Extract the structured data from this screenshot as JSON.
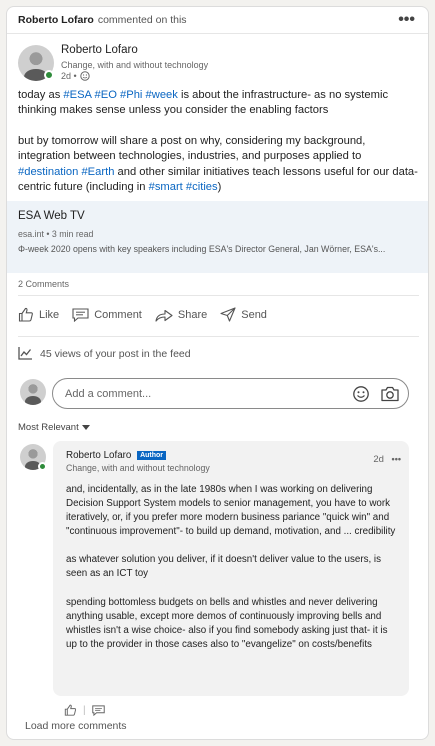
{
  "activity": {
    "author": "Roberto Lofaro",
    "text": "commented on this",
    "more": "•••"
  },
  "post": {
    "author_name": "Roberto Lofaro",
    "headline": "Change, with and without technology",
    "time": "2d •",
    "paragraphs": [
      {
        "segments": [
          {
            "t": "today as "
          },
          {
            "t": "#ESA",
            "tag": true
          },
          {
            "t": " "
          },
          {
            "t": "#EO",
            "tag": true
          },
          {
            "t": " "
          },
          {
            "t": "#Phi",
            "tag": true
          },
          {
            "t": " "
          },
          {
            "t": "#week",
            "tag": true
          },
          {
            "t": " is about the infrastructure- as no systemic thinking makes sense unless you consider the enabling factors"
          }
        ]
      },
      {
        "segments": [
          {
            "t": "but by tomorrow will share a post on why, considering my background, integration between technologies, industries, and purposes applied to "
          },
          {
            "t": "#destination",
            "tag": true
          },
          {
            "t": " "
          },
          {
            "t": "#Earth",
            "tag": true
          },
          {
            "t": " and other similar initiatives teach lessons useful for our data-centric future (including in "
          },
          {
            "t": "#smart",
            "tag": true
          },
          {
            "t": " "
          },
          {
            "t": "#cities",
            "tag": true
          },
          {
            "t": ")"
          }
        ]
      }
    ]
  },
  "link_card": {
    "title": "ESA Web TV",
    "domain": "esa.int • 3 min read",
    "description": "Φ-week 2020 opens with key speakers including ESA's Director General, Jan Wörner, ESA's..."
  },
  "social": {
    "comments_count": "2 Comments",
    "actions": [
      "Like",
      "Comment",
      "Share",
      "Send"
    ],
    "views": "45 views of your post in the feed"
  },
  "comment_box": {
    "placeholder": "Add a comment..."
  },
  "sort": {
    "label": "Most Relevant"
  },
  "reply": {
    "author_name": "Roberto Lofaro",
    "badge": "Author",
    "headline": "Change, with and without technology",
    "time": "2d",
    "more": "•••",
    "paragraphs": [
      "and, incidentally, as in the late 1980s when I was working on delivering Decision Support System models to senior management, you have to work iteratively, or, if you prefer more modern business pariance \"quick win\" and \"continuous improvement\"- to build up demand, motivation, and ... credibility",
      "as whatever solution you deliver, if it doesn't deliver value to the users, is seen as an ICT toy",
      "spending bottomless budgets on bells and whistles and never delivering anything usable, except more demos of continuously improving bells and whistles isn't a wise choice- also if you find somebody asking just that- it is up to the provider in those cases also to \"evangelize\" on costs/benefits"
    ]
  },
  "load_more": "Load more comments",
  "colors": {
    "link": "#0a66c2",
    "online": "#2e8b3a",
    "card_bg": "#eef3f8",
    "reply_bg": "#f2f2f2"
  }
}
